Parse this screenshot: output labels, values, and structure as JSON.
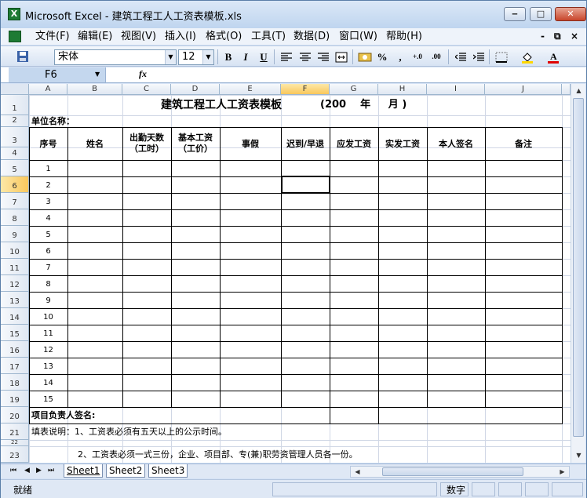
{
  "window": {
    "title": "Microsoft Excel - 建筑工程工人工资表模板.xls",
    "min_label": "‒",
    "max_label": "□",
    "close_label": "✕",
    "app_icon": "X"
  },
  "menu": [
    "文件(F)",
    "编辑(E)",
    "视图(V)",
    "插入(I)",
    "格式(O)",
    "工具(T)",
    "数据(D)",
    "窗口(W)",
    "帮助(H)"
  ],
  "mdi": {
    "min": "-",
    "restore": "⧉",
    "close": "×"
  },
  "toolbar": {
    "font": "宋体",
    "size": "12",
    "bold": "B",
    "italic": "I",
    "underline": "U",
    "percent": "%",
    "comma": ",",
    "inc_dec": "+.0",
    "dec_dec": ".00"
  },
  "formula": {
    "name_box": "F6",
    "fx": "fx",
    "content": ""
  },
  "columns": [
    "A",
    "B",
    "C",
    "D",
    "E",
    "F",
    "G",
    "H",
    "I",
    "J"
  ],
  "selected_column": "F",
  "rows": [
    "1",
    "2",
    "3",
    "4",
    "5",
    "6",
    "7",
    "8",
    "9",
    "10",
    "11",
    "12",
    "13",
    "14",
    "15",
    "16",
    "17",
    "18",
    "19",
    "20",
    "21",
    "22",
    "23"
  ],
  "selected_row": "6",
  "sheet": {
    "title": "建筑工程工人工资表模板",
    "title_date": "(200    年     月 )",
    "unit_label": "单位名称：",
    "headers": {
      "seq": "序号",
      "name": "姓名",
      "days_1": "出勤天数",
      "days_2": "（工时）",
      "wage_1": "基本工资",
      "wage_2": "（工价）",
      "leave": "事假",
      "late": "迟到/早退",
      "payable": "应发工资",
      "actual": "实发工资",
      "sign": "本人签名",
      "remark": "备注"
    },
    "numbers": [
      "1",
      "2",
      "3",
      "4",
      "5",
      "6",
      "7",
      "8",
      "9",
      "10",
      "11",
      "12",
      "13",
      "14",
      "15"
    ],
    "manager_sign": "项目负责人签名:",
    "note1": "填表说明：1、工资表必须有五天以上的公示时间。",
    "note2": "2、工资表必须一式三份，企业、项目部、专(兼)职劳资管理人员各一份。"
  },
  "tabs": [
    "Sheet1",
    "Sheet2",
    "Sheet3"
  ],
  "active_tab": "Sheet1",
  "status": {
    "ready": "就绪",
    "mode": "数字"
  },
  "colors": {
    "title_bar": "#bfd5ef",
    "selection_header": "#f9c75c",
    "gridline": "#d0d7e5"
  }
}
